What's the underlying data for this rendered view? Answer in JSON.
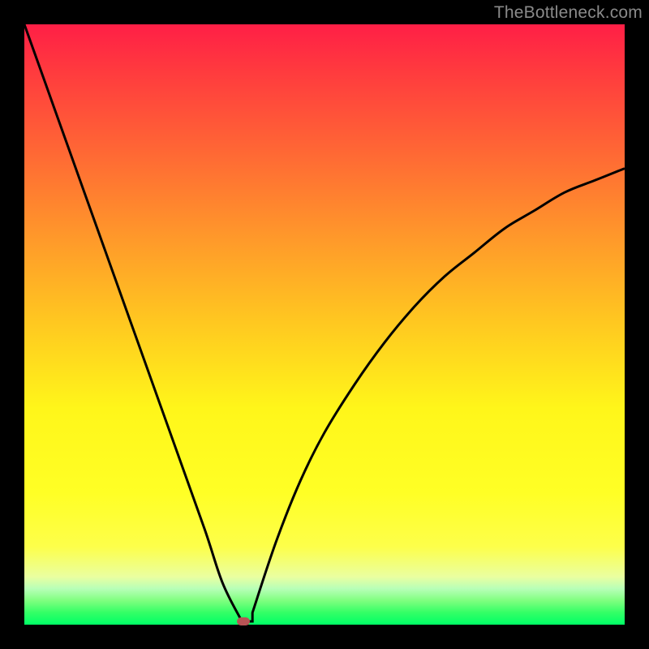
{
  "watermark": "TheBottleneck.com",
  "colors": {
    "background": "#000000",
    "curve_stroke": "#000000",
    "marker_fill": "#b75455"
  },
  "chart_data": {
    "type": "line",
    "title": "",
    "xlabel": "",
    "ylabel": "",
    "xlim": [
      0,
      100
    ],
    "ylim": [
      0,
      100
    ],
    "legend": false,
    "grid": false,
    "left_branch": {
      "x": [
        0,
        5,
        10,
        15,
        20,
        25,
        30,
        33,
        36
      ],
      "y": [
        100,
        86,
        72,
        58,
        44,
        30,
        16,
        7,
        1
      ]
    },
    "right_branch": {
      "x": [
        38,
        42,
        46,
        50,
        55,
        60,
        65,
        70,
        75,
        80,
        85,
        90,
        95,
        100
      ],
      "y": [
        2,
        14,
        24,
        32,
        40,
        47,
        53,
        58,
        62,
        66,
        69,
        72,
        74,
        76
      ]
    },
    "marker": {
      "x": 36.5,
      "y": 0.5
    },
    "annotations": []
  }
}
